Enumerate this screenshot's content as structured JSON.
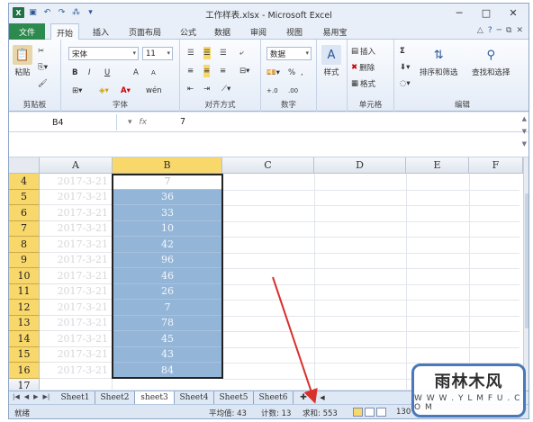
{
  "window": {
    "title": "工作样表.xlsx - Microsoft Excel",
    "min": "─",
    "max": "□",
    "close": "✕"
  },
  "ribbon_tabs": [
    "文件",
    "开始",
    "插入",
    "页面布局",
    "公式",
    "数据",
    "审阅",
    "视图",
    "易用宝"
  ],
  "ribbon": {
    "clipboard": {
      "label": "剪贴板",
      "paste": "粘贴"
    },
    "font": {
      "label": "字体",
      "font_name": "宋体",
      "font_size": "11",
      "bold": "B",
      "italic": "I",
      "underline": "U",
      "grow": "A",
      "shrink": "A",
      "wen": "wén"
    },
    "align": {
      "label": "对齐方式"
    },
    "number": {
      "label": "数字",
      "format": "数据",
      "percent": "%",
      "comma": ",",
      "inc": "+.0",
      "dec": ".00"
    },
    "styles": {
      "label": "样式"
    },
    "cells": {
      "label": "单元格",
      "insert": "插入",
      "delete": "删除",
      "format": "格式"
    },
    "editing": {
      "label": "编辑",
      "sort": "排序和筛选",
      "find": "查找和选择",
      "sigma": "Σ"
    }
  },
  "formula_bar": {
    "name_box": "B4",
    "fx": "fx",
    "value": "7"
  },
  "columns": [
    "A",
    "B",
    "C",
    "D",
    "E",
    "F"
  ],
  "rows": [
    {
      "n": "4",
      "a": "2017-3-21",
      "b": "7"
    },
    {
      "n": "5",
      "a": "2017-3-21",
      "b": "36"
    },
    {
      "n": "6",
      "a": "2017-3-21",
      "b": "33"
    },
    {
      "n": "7",
      "a": "2017-3-21",
      "b": "10"
    },
    {
      "n": "8",
      "a": "2017-3-21",
      "b": "42"
    },
    {
      "n": "9",
      "a": "2017-3-21",
      "b": "96"
    },
    {
      "n": "10",
      "a": "2017-3-21",
      "b": "46"
    },
    {
      "n": "11",
      "a": "2017-3-21",
      "b": "26"
    },
    {
      "n": "12",
      "a": "2017-3-21",
      "b": "7"
    },
    {
      "n": "13",
      "a": "2017-3-21",
      "b": "78"
    },
    {
      "n": "14",
      "a": "2017-3-21",
      "b": "45"
    },
    {
      "n": "15",
      "a": "2017-3-21",
      "b": "43"
    },
    {
      "n": "16",
      "a": "2017-3-21",
      "b": "84"
    },
    {
      "n": "17",
      "a": "",
      "b": ""
    }
  ],
  "sheets": [
    "Sheet1",
    "Sheet2",
    "sheet3",
    "Sheet4",
    "Sheet5",
    "Sheet6"
  ],
  "active_sheet": "sheet3",
  "status": {
    "ready": "就绪",
    "average": "平均值: 43",
    "count": "计数: 13",
    "sum": "求和: 553",
    "zoom": "130"
  },
  "watermark": {
    "big": "雨林木风",
    "small": "W W W . Y L M F U . C O M"
  },
  "colors": {
    "selection": "#93b5d8",
    "header_sel": "#f8d76b",
    "file_tab": "#2d8a4e",
    "arrow": "#d9302c"
  }
}
